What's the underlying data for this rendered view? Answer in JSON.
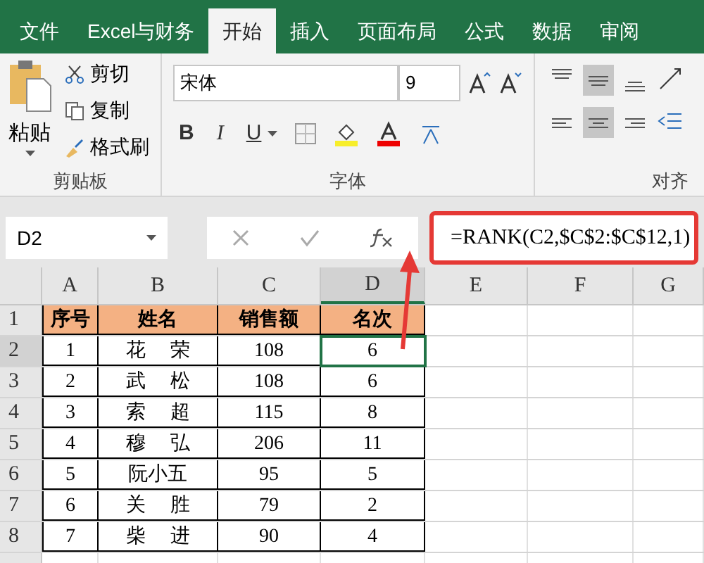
{
  "tabs": [
    {
      "label": "文件",
      "selected": false
    },
    {
      "label": "Excel与财务",
      "selected": false
    },
    {
      "label": "开始",
      "selected": true
    },
    {
      "label": "插入",
      "selected": false
    },
    {
      "label": "页面布局",
      "selected": false
    },
    {
      "label": "公式",
      "selected": false
    },
    {
      "label": "数据",
      "selected": false
    },
    {
      "label": "审阅",
      "selected": false
    }
  ],
  "clipboard": {
    "paste": "粘贴",
    "items": [
      {
        "kind": "cut",
        "label": "剪切"
      },
      {
        "kind": "copy",
        "label": "复制"
      },
      {
        "kind": "painter",
        "label": "格式刷"
      }
    ],
    "group_label": "剪贴板"
  },
  "font": {
    "name": "宋体",
    "size": "9",
    "group_label": "字体",
    "format_buttons": [
      "B",
      "I",
      "U"
    ]
  },
  "alignment": {
    "group_label": "对齐",
    "vertical": [
      {
        "selected": false
      },
      {
        "selected": true
      },
      {
        "selected": false
      }
    ],
    "horizontal": [
      {
        "selected": false
      },
      {
        "selected": true
      },
      {
        "selected": false
      }
    ]
  },
  "formula_bar": {
    "name_box": "D2",
    "formula": "=RANK(C2,$C$2:$C$12,1)"
  },
  "columns": [
    {
      "label": "A",
      "selected": false
    },
    {
      "label": "B",
      "selected": false
    },
    {
      "label": "C",
      "selected": false
    },
    {
      "label": "D",
      "selected": true
    },
    {
      "label": "E",
      "selected": false
    },
    {
      "label": "F",
      "selected": false
    },
    {
      "label": "G",
      "selected": false
    }
  ],
  "rows": [
    {
      "number": "1",
      "kind": "header",
      "selected": false,
      "cells": [
        "序号",
        "姓名",
        "销售额",
        "名次"
      ]
    },
    {
      "number": "2",
      "kind": "data",
      "selected": true,
      "cells": [
        "1",
        "花 荣",
        "108",
        "6"
      ]
    },
    {
      "number": "3",
      "kind": "data",
      "selected": false,
      "cells": [
        "2",
        "武 松",
        "108",
        "6"
      ]
    },
    {
      "number": "4",
      "kind": "data",
      "selected": false,
      "cells": [
        "3",
        "索 超",
        "115",
        "8"
      ]
    },
    {
      "number": "5",
      "kind": "data",
      "selected": false,
      "cells": [
        "4",
        "穆 弘",
        "206",
        "11"
      ]
    },
    {
      "number": "6",
      "kind": "data",
      "selected": false,
      "cells": [
        "5",
        "阮小五",
        "95",
        "5"
      ]
    },
    {
      "number": "7",
      "kind": "data",
      "selected": false,
      "cells": [
        "6",
        "关 胜",
        "79",
        "2"
      ]
    },
    {
      "number": "8",
      "kind": "data",
      "selected": false,
      "cells": [
        "7",
        "柴 进",
        "90",
        "4"
      ]
    }
  ]
}
